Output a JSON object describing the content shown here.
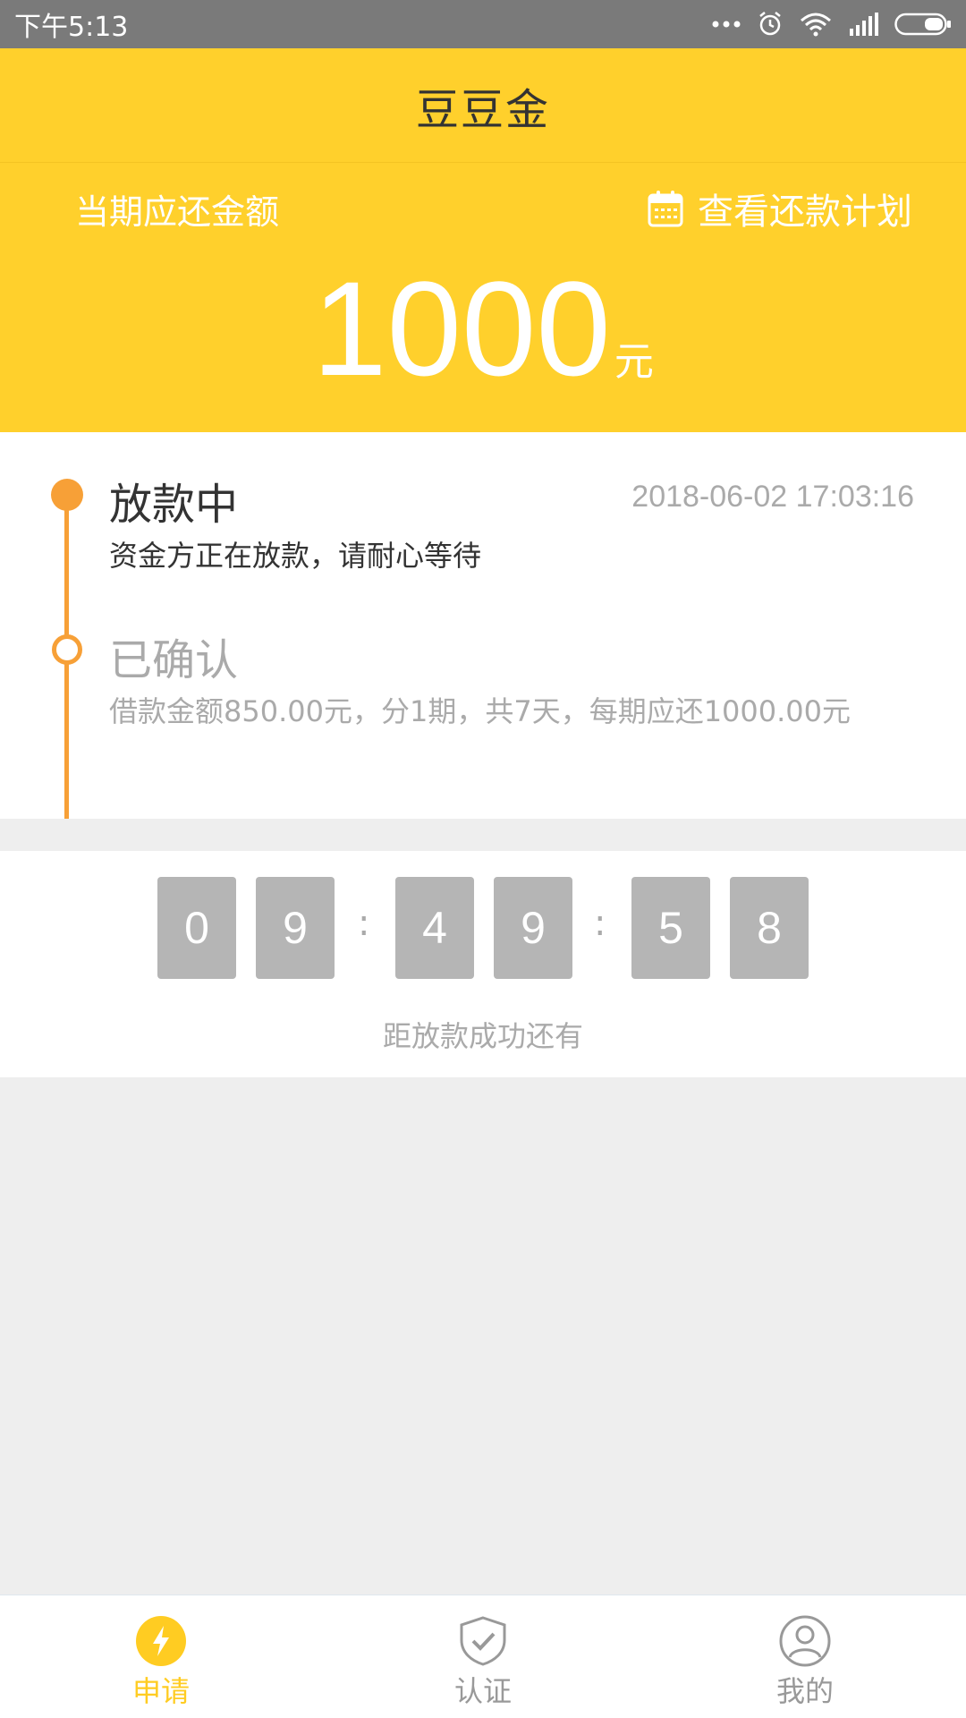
{
  "status_bar": {
    "time": "下午5:13"
  },
  "header": {
    "title": "豆豆金"
  },
  "hero": {
    "due_label": "当期应还金额",
    "plan_link": "查看还款计划",
    "amount": "1000",
    "unit": "元"
  },
  "timeline": {
    "steps": [
      {
        "title": "放款中",
        "time": "2018-06-02 17:03:16",
        "desc": "资金方正在放款，请耐心等待"
      },
      {
        "title": "已确认",
        "desc": "借款金额850.00元，分1期，共7天，每期应还1000.00元"
      }
    ]
  },
  "countdown": {
    "digits": [
      "0",
      "9",
      "4",
      "9",
      "5",
      "8"
    ],
    "separator": ":",
    "label": "距放款成功还有"
  },
  "tabbar": {
    "items": [
      {
        "label": "申请",
        "icon": "lightning-icon",
        "active": true
      },
      {
        "label": "认证",
        "icon": "shield-check-icon",
        "active": false
      },
      {
        "label": "我的",
        "icon": "user-icon",
        "active": false
      }
    ]
  },
  "colors": {
    "brand": "#ffd02c",
    "timeline": "#f7a037",
    "tab_active": "#ffcc22",
    "tab_inactive": "#999999"
  }
}
